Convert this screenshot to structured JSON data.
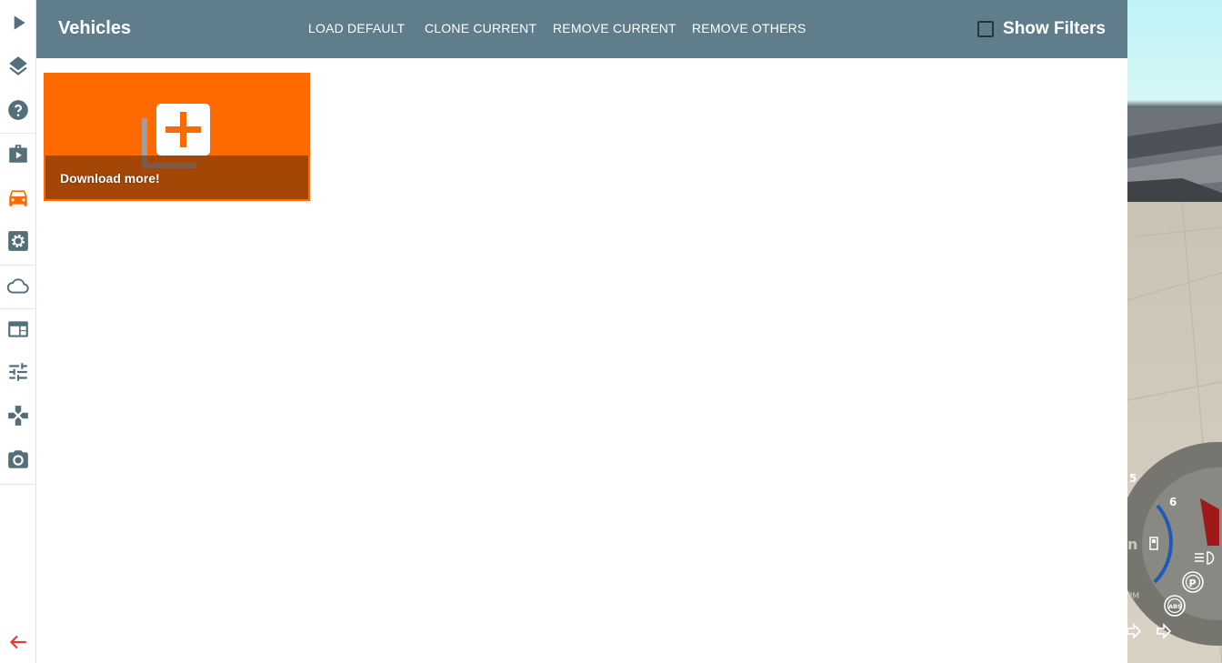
{
  "sidebar": {
    "items": [
      {
        "icon": "play-icon",
        "active": false
      },
      {
        "icon": "layers-icon",
        "active": false
      },
      {
        "icon": "help-icon",
        "active": false
      },
      {
        "icon": "scenario-icon",
        "active": false
      },
      {
        "icon": "car-icon",
        "active": true
      },
      {
        "icon": "gear-icon",
        "active": false
      },
      {
        "icon": "cloud-icon",
        "active": false
      },
      {
        "icon": "app-window-icon",
        "active": false
      },
      {
        "icon": "tune-icon",
        "active": false
      },
      {
        "icon": "gamepad-icon",
        "active": false
      },
      {
        "icon": "camera-icon",
        "active": false
      }
    ],
    "back_icon": "back-arrow-icon"
  },
  "header": {
    "title": "Vehicles",
    "buttons": [
      "LOAD DEFAULT",
      "CLONE CURRENT",
      "REMOVE CURRENT",
      "REMOVE OTHERS"
    ],
    "filters_label": "Show Filters",
    "filters_checked": false
  },
  "tiles": [
    {
      "label": "Download more!",
      "icon": "add-to-library-icon"
    }
  ],
  "gauge": {
    "tick_labels": [
      "5",
      "6"
    ],
    "unit_partial": "n",
    "unit_small": "PM",
    "indicators": [
      "fuel-icon",
      "headlight-icon",
      "parking-brake-icon",
      "abs-icon",
      "turn-left-icon",
      "turn-right-icon"
    ],
    "parking_label": "P",
    "abs_label": "ABS"
  },
  "colors": {
    "header_bg": "#607d8b",
    "accent": "#ff6a00",
    "icon_default": "#546e7a",
    "icon_active": "#ff6a00",
    "back_arrow": "#e53935"
  }
}
